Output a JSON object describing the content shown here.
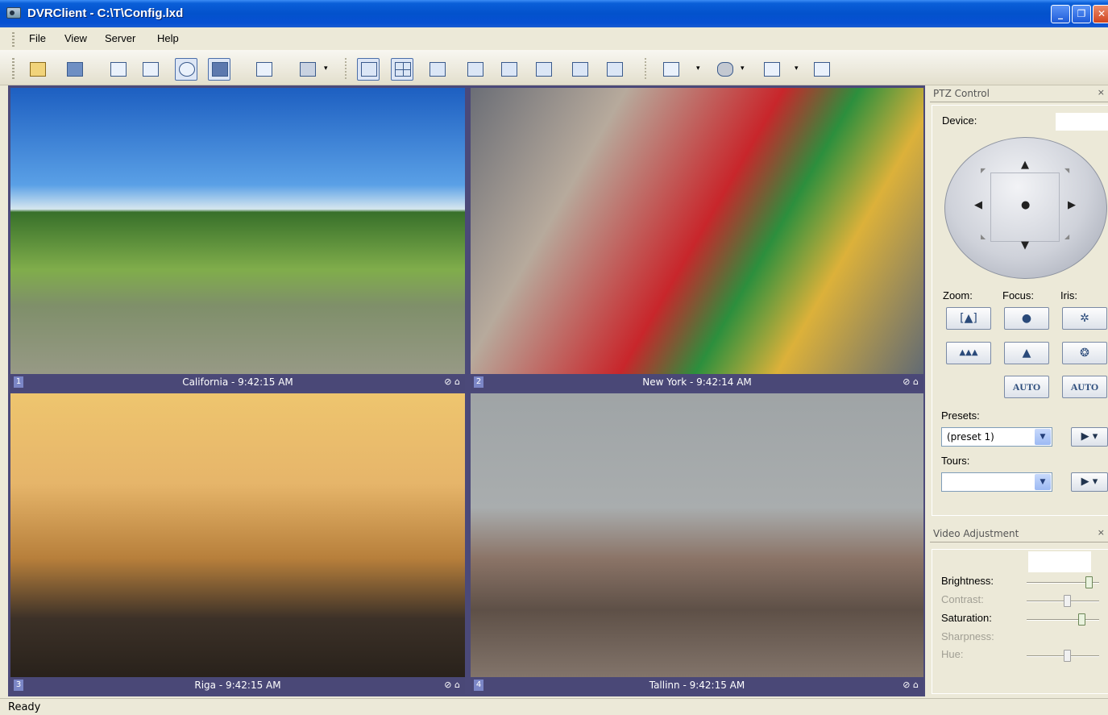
{
  "window": {
    "title": "DVRClient - C:\\T\\Config.lxd",
    "controls": {
      "minimize": "_",
      "maximize": "❐",
      "close": "✕"
    }
  },
  "menu": [
    "File",
    "View",
    "Server",
    "Help"
  ],
  "toolbar": {
    "icons": [
      "open-folder-icon",
      "save-icon",
      "properties-icon",
      "edit-icon",
      "record-icon",
      "playback-icon",
      "fullscreen-icon",
      "print-icon"
    ],
    "layouts": [
      "1x1",
      "2x2",
      "3x3",
      "4x4",
      "1+5",
      "1+7",
      "3x4",
      "4x4-alt"
    ],
    "extra_icons": [
      "snapshot-icon",
      "ptz-hand-icon",
      "motion-icon",
      "window-icon"
    ],
    "dropdown_glyph": "▾"
  },
  "video": {
    "cells": [
      {
        "num": "1",
        "label": "California - 9:42:15 AM"
      },
      {
        "num": "2",
        "label": "New York - 9:42:14 AM"
      },
      {
        "num": "3",
        "label": "Riga - 9:42:15 AM"
      },
      {
        "num": "4",
        "label": "Tallinn - 9:42:15 AM"
      }
    ],
    "cell_icons": "⊘ ⌂"
  },
  "ptz": {
    "title": "PTZ Control",
    "close": "×",
    "device_label": "Device:",
    "arrows": {
      "up": "▲",
      "down": "▼",
      "left": "◀",
      "right": "▶",
      "center": "●",
      "ul": "◤",
      "ur": "◥",
      "dl": "◣",
      "dr": "◢"
    },
    "zoom_label": "Zoom:",
    "focus_label": "Focus:",
    "iris_label": "Iris:",
    "buttons": {
      "zoom_in": "[▲]",
      "zoom_out": "▲▲▲",
      "focus_near": "●",
      "focus_far": "▲",
      "iris_open": "✲",
      "iris_close": "❂",
      "focus_auto": "AUTO",
      "iris_auto": "AUTO"
    },
    "presets_label": "Presets:",
    "preset_value": "(preset 1)",
    "tours_label": "Tours:",
    "tour_value": "",
    "play": "▶ ▾",
    "combo_arrow": "▼"
  },
  "video_adjustment": {
    "title": "Video Adjustment",
    "close": "×",
    "sliders": [
      {
        "label": "Brightness:",
        "value": 0.85,
        "enabled": true
      },
      {
        "label": "Contrast:",
        "value": 0.55,
        "enabled": false
      },
      {
        "label": "Saturation:",
        "value": 0.75,
        "enabled": true
      },
      {
        "label": "Sharpness:",
        "value": null,
        "enabled": false
      },
      {
        "label": "Hue:",
        "value": 0.55,
        "enabled": false
      }
    ]
  },
  "status": "Ready"
}
